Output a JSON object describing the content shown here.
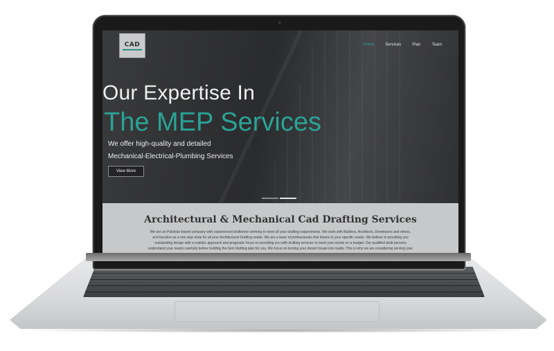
{
  "site": {
    "logo_text": "CAD",
    "nav": [
      {
        "label": "Home",
        "active": true
      },
      {
        "label": "Services",
        "active": false
      },
      {
        "label": "Plan",
        "active": false
      },
      {
        "label": "Team",
        "active": false
      }
    ],
    "hero": {
      "subtitle": "Our Expertise In",
      "title": "The MEP Services",
      "desc_line1": "We offer high-quality and detailed",
      "desc_line2": "Mechanical-Electrical-Plumbing Services",
      "button": "View More"
    },
    "about": {
      "title": "Architectural & Mechanical Cad Drafting Services",
      "text_lines": [
        "We are an Pakistan based company with experienced draftsmen working to meet all your drafting requirements. We work with Builders, Architects, Developers and others,",
        "and function as a one stop shop for all your Architectural Drafting needs. We are a team of professionals that listens to your specific needs. We believe in providing you",
        "outstanding design with a realistic approach and pragmatic focus on providing you with drafting services to meet your needs on a budget. Our qualified draft persons",
        "understand your needs carefully before building the best drafting plan for you. We focus on turning your dream house into reality. This is why we are considering serving your"
      ]
    }
  },
  "colors": {
    "accent": "#2aa396",
    "hero_bg": "#2d2e30",
    "about_bg": "#c7c8c9"
  }
}
